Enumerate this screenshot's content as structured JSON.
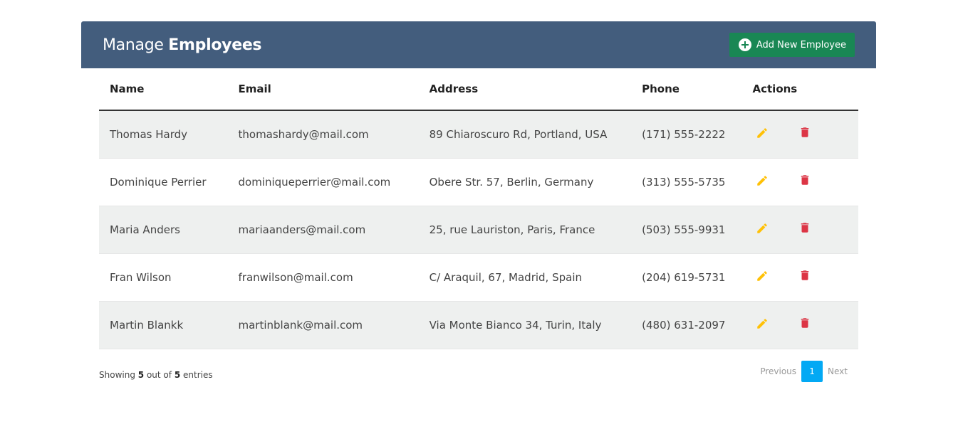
{
  "header": {
    "title_prefix": "Manage",
    "title_bold": "Employees",
    "add_button_label": "Add New Employee"
  },
  "table": {
    "columns": [
      "Name",
      "Email",
      "Address",
      "Phone",
      "Actions"
    ],
    "rows": [
      {
        "name": "Thomas Hardy",
        "email": "thomashardy@mail.com",
        "address": "89 Chiaroscuro Rd, Portland, USA",
        "phone": "(171) 555-2222"
      },
      {
        "name": "Dominique Perrier",
        "email": "dominiqueperrier@mail.com",
        "address": "Obere Str. 57, Berlin, Germany",
        "phone": "(313) 555-5735"
      },
      {
        "name": "Maria Anders",
        "email": "mariaanders@mail.com",
        "address": "25, rue Lauriston, Paris, France",
        "phone": "(503) 555-9931"
      },
      {
        "name": "Fran Wilson",
        "email": "franwilson@mail.com",
        "address": "C/ Araquil, 67, Madrid, Spain",
        "phone": "(204) 619-5731"
      },
      {
        "name": "Martin Blankk",
        "email": "martinblank@mail.com",
        "address": "Via Monte Bianco 34, Turin, Italy",
        "phone": "(480) 631-2097"
      }
    ],
    "action_icons": {
      "edit": "pencil-icon",
      "delete": "trash-icon"
    }
  },
  "footer": {
    "showing_prefix": "Showing",
    "showing_count": "5",
    "showing_middle": "out of",
    "showing_total": "5",
    "showing_suffix": "entries"
  },
  "pagination": {
    "previous_label": "Previous",
    "current_page": "1",
    "next_label": "Next"
  },
  "colors": {
    "header_bg": "#435d7d",
    "add_button": "#198754",
    "edit_icon": "#ffc107",
    "delete_icon": "#dc3545",
    "active_page": "#03a9f4"
  }
}
